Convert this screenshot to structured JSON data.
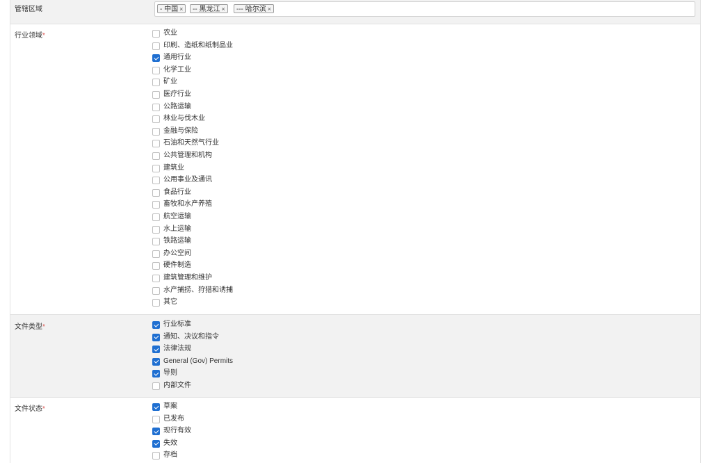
{
  "region": {
    "label": "管辖区域",
    "tags": [
      "- 中国",
      "-- 黑龙江",
      "--- 哈尔滨"
    ],
    "remove_glyph": "×"
  },
  "industry": {
    "label": "行业领域",
    "required_mark": "*",
    "options": [
      {
        "label": "农业",
        "checked": false
      },
      {
        "label": "印刷、造纸和纸制品业",
        "checked": false
      },
      {
        "label": "通用行业",
        "checked": true
      },
      {
        "label": "化学工业",
        "checked": false
      },
      {
        "label": "矿业",
        "checked": false
      },
      {
        "label": "医疗行业",
        "checked": false
      },
      {
        "label": "公路运输",
        "checked": false
      },
      {
        "label": "林业与伐木业",
        "checked": false
      },
      {
        "label": "金融与保险",
        "checked": false
      },
      {
        "label": "石油和天然气行业",
        "checked": false
      },
      {
        "label": "公共管理和机构",
        "checked": false
      },
      {
        "label": "建筑业",
        "checked": false
      },
      {
        "label": "公用事业及通讯",
        "checked": false
      },
      {
        "label": "食品行业",
        "checked": false
      },
      {
        "label": "畜牧和水产养殖",
        "checked": false
      },
      {
        "label": "航空运输",
        "checked": false
      },
      {
        "label": "水上运输",
        "checked": false
      },
      {
        "label": "铁路运输",
        "checked": false
      },
      {
        "label": "办公空间",
        "checked": false
      },
      {
        "label": "硬件制造",
        "checked": false
      },
      {
        "label": "建筑管理和维护",
        "checked": false
      },
      {
        "label": "水产捕捞、狩猎和诱捕",
        "checked": false
      },
      {
        "label": "其它",
        "checked": false
      }
    ]
  },
  "doc_type": {
    "label": "文件类型",
    "required_mark": "*",
    "options": [
      {
        "label": "行业标准",
        "checked": true
      },
      {
        "label": "通知、决议和指令",
        "checked": true
      },
      {
        "label": "法律法规",
        "checked": true
      },
      {
        "label": "General (Gov) Permits",
        "checked": true
      },
      {
        "label": "导则",
        "checked": true
      },
      {
        "label": "内部文件",
        "checked": false
      }
    ]
  },
  "doc_status": {
    "label": "文件状态",
    "required_mark": "*",
    "options": [
      {
        "label": "草案",
        "checked": true
      },
      {
        "label": "已发布",
        "checked": false
      },
      {
        "label": "现行有效",
        "checked": true
      },
      {
        "label": "失效",
        "checked": true
      },
      {
        "label": "存档",
        "checked": false
      }
    ]
  },
  "colors": {
    "checkbox_checked": "#1f6fd1",
    "required": "#d9534f",
    "row_alt_bg": "#f2f2f2"
  }
}
